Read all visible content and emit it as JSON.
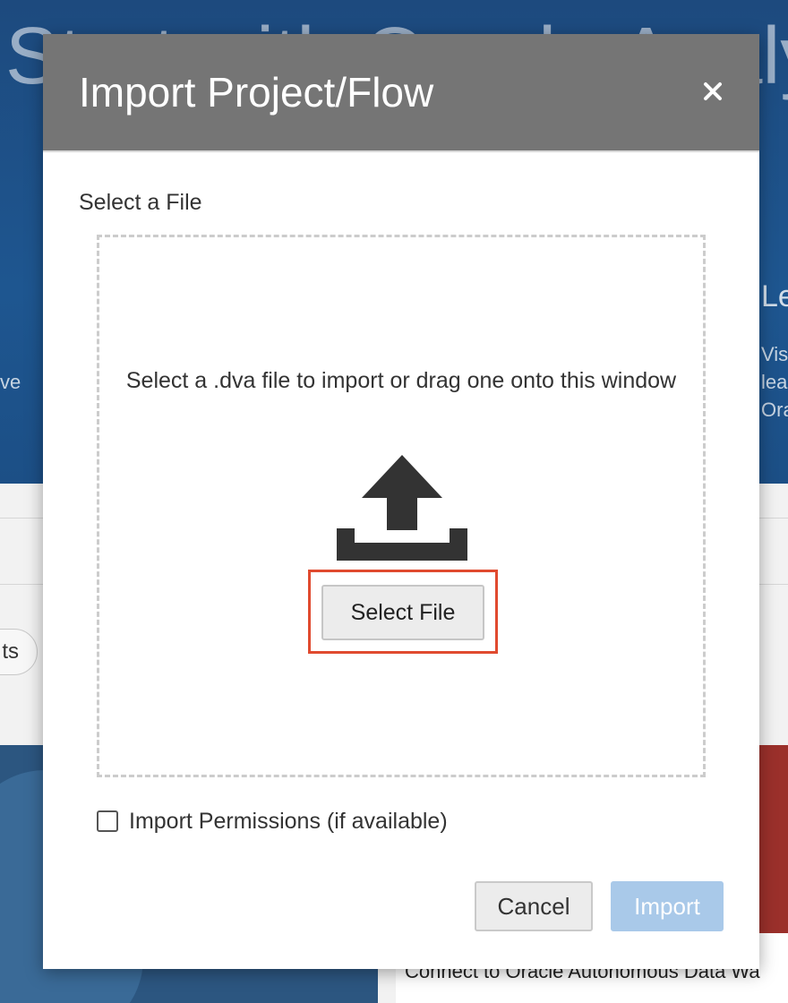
{
  "background": {
    "hero_title": "Start with Oracle Analytics",
    "hero_left_text": "ve",
    "hero_right_heading": "Le",
    "hero_right_lines": [
      "Vis",
      "lea",
      "Ora"
    ],
    "pill_label": "ts",
    "card_right_text": "Connect to Oracle Autonomous Data Wa"
  },
  "dialog": {
    "title": "Import Project/Flow",
    "close_icon": "close-icon",
    "select_label": "Select a File",
    "dropzone_message": "Select a .dva file to import or drag one onto this window",
    "upload_icon": "upload-icon",
    "select_file_button": "Select File",
    "import_permissions_label": "Import Permissions (if available)",
    "import_permissions_checked": false,
    "cancel_button": "Cancel",
    "import_button": "Import",
    "import_enabled": false
  },
  "colors": {
    "header_bg": "#757575",
    "highlight_border": "#e04a2f",
    "import_disabled_bg": "#a9c9e9",
    "hero_bg": "#1e5690"
  }
}
